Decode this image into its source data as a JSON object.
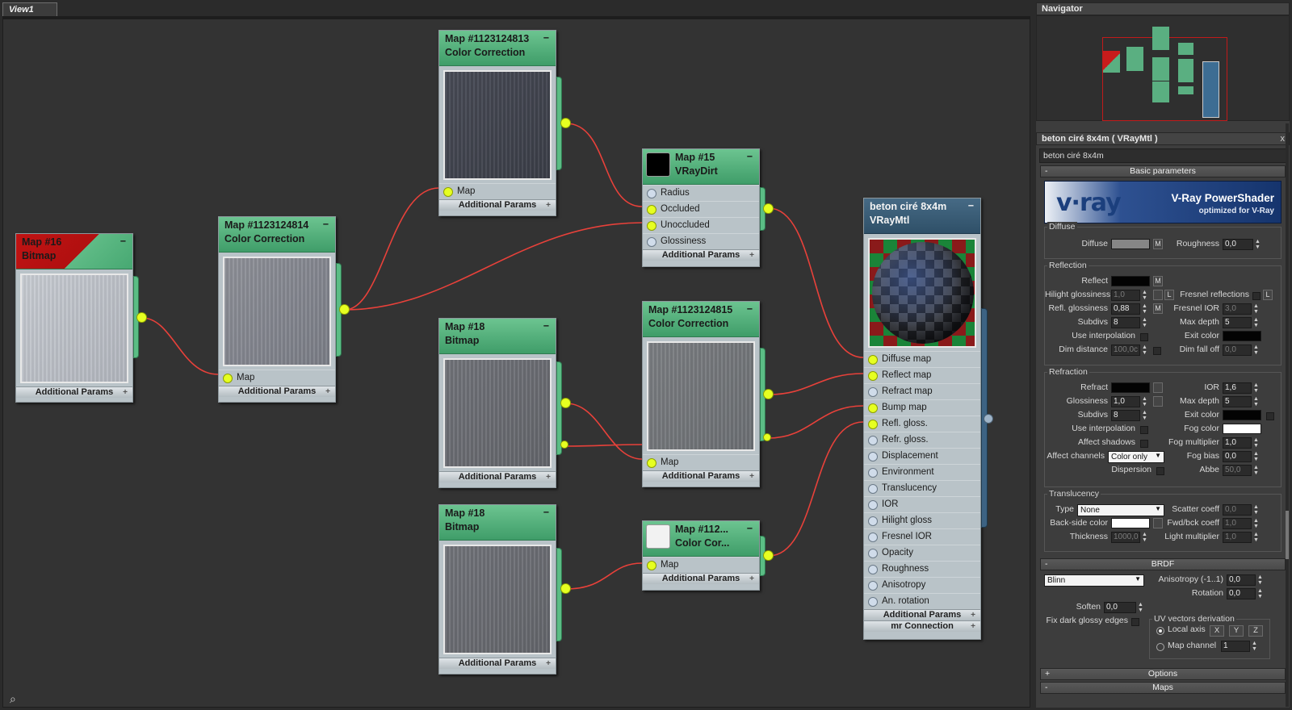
{
  "view": {
    "tab": "View1"
  },
  "nodes": {
    "bitmap16": {
      "title1": "Map #16",
      "title2": "Bitmap",
      "addp": "Additional Params"
    },
    "cc814": {
      "title1": "Map #1123124814",
      "title2": "Color Correction",
      "socket": "Map",
      "addp": "Additional Params"
    },
    "cc813": {
      "title1": "Map #1123124813",
      "title2": "Color Correction",
      "socket": "Map",
      "addp": "Additional Params"
    },
    "dirt": {
      "title1": "Map #15",
      "title2": "VRayDirt",
      "sockets": [
        "Radius",
        "Occluded",
        "Unoccluded",
        "Glossiness"
      ],
      "addp": "Additional Params"
    },
    "bitmap18a": {
      "title1": "Map #18",
      "title2": "Bitmap",
      "addp": "Additional Params"
    },
    "cc815": {
      "title1": "Map #1123124815",
      "title2": "Color Correction",
      "socket": "Map",
      "addp": "Additional Params"
    },
    "bitmap18b": {
      "title1": "Map #18",
      "title2": "Bitmap",
      "addp": "Additional Params"
    },
    "cc112": {
      "title1": "Map #112...",
      "title2": "Color Cor...",
      "socket": "Map",
      "addp": "Additional Params"
    },
    "mtl": {
      "title1": "beton ciré 8x4m",
      "title2": "VRayMtl",
      "sockets": [
        "Diffuse map",
        "Reflect map",
        "Refract map",
        "Bump map",
        "Refl. gloss.",
        "Refr. gloss.",
        "Displacement",
        "Environment",
        "Translucency",
        "IOR",
        "Hilight gloss",
        "Fresnel IOR",
        "Opacity",
        "Roughness",
        "Anisotropy",
        "An. rotation"
      ],
      "addp": "Additional Params",
      "mr": "mr Connection"
    }
  },
  "navigator": {
    "title": "Navigator",
    "close": "x"
  },
  "material_panel": {
    "title": "beton ciré 8x4m  ( VRayMtl )",
    "close": "x",
    "name_field": "beton ciré 8x4m",
    "rollout_basic": {
      "sign": "-",
      "label": "Basic parameters"
    },
    "banner": {
      "logo": "v·ray",
      "title": "V-Ray PowerShader",
      "subtitle": "optimized for V-Ray"
    },
    "diffuse": {
      "group": "Diffuse",
      "diffuse_label": "Diffuse",
      "m_btn": "M",
      "roughness_label": "Roughness",
      "roughness": "0,0"
    },
    "reflection": {
      "group": "Reflection",
      "reflect_label": "Reflect",
      "m_btn": "M",
      "hilight_label": "Hilight glossiness",
      "hilight": "1,0",
      "l_btn": "L",
      "fresnel_label": "Fresnel reflections",
      "fresnel_l": "L",
      "refl_gloss_label": "Refl. glossiness",
      "refl_gloss": "0,88",
      "refl_m": "M",
      "fresnel_ior_label": "Fresnel IOR",
      "fresnel_ior": "3,0",
      "subdivs_label": "Subdivs",
      "subdivs": "8",
      "maxdepth_label": "Max depth",
      "maxdepth": "5",
      "useinterp_label": "Use interpolation",
      "exitcolor_label": "Exit color",
      "dimdist_label": "Dim distance",
      "dimdist": "100,0c",
      "dimfall_label": "Dim fall off",
      "dimfall": "0,0"
    },
    "refraction": {
      "group": "Refraction",
      "refract_label": "Refract",
      "ior_label": "IOR",
      "ior": "1,6",
      "gloss_label": "Glossiness",
      "gloss": "1,0",
      "maxdepth_label": "Max depth",
      "maxdepth": "5",
      "subdivs_label": "Subdivs",
      "subdivs": "8",
      "exitcolor_label": "Exit color",
      "useinterp_label": "Use interpolation",
      "fogcolor_label": "Fog color",
      "affectshadows_label": "Affect shadows",
      "fogmult_label": "Fog multiplier",
      "fogmult": "1,0",
      "affectch_label": "Affect channels",
      "affectch": "Color only",
      "fogbias_label": "Fog bias",
      "fogbias": "0,0",
      "dispersion_label": "Dispersion",
      "abbe_label": "Abbe",
      "abbe": "50,0"
    },
    "translucency": {
      "group": "Translucency",
      "type_label": "Type",
      "type": "None",
      "scatter_label": "Scatter coeff",
      "scatter": "0,0",
      "backside_label": "Back-side color",
      "fwdbck_label": "Fwd/bck coeff",
      "fwdbck": "1,0",
      "thickness_label": "Thickness",
      "thickness": "1000,0",
      "lightmult_label": "Light multiplier",
      "lightmult": "1,0"
    },
    "brdf": {
      "sign": "-",
      "label": "BRDF",
      "type": "Blinn",
      "aniso_label": "Anisotropy (-1..1)",
      "aniso": "0,0",
      "rotation_label": "Rotation",
      "rotation": "0,0",
      "soften_label": "Soften",
      "soften": "0,0",
      "uv_label": "UV vectors derivation",
      "fixdark_label": "Fix dark glossy edges",
      "localaxis_label": "Local axis",
      "x": "X",
      "y": "Y",
      "z": "Z",
      "mapch_label": "Map channel",
      "mapch": "1"
    },
    "rollout_options": {
      "sign": "+",
      "label": "Options"
    },
    "rollout_maps": {
      "sign": "-",
      "label": "Maps"
    }
  }
}
